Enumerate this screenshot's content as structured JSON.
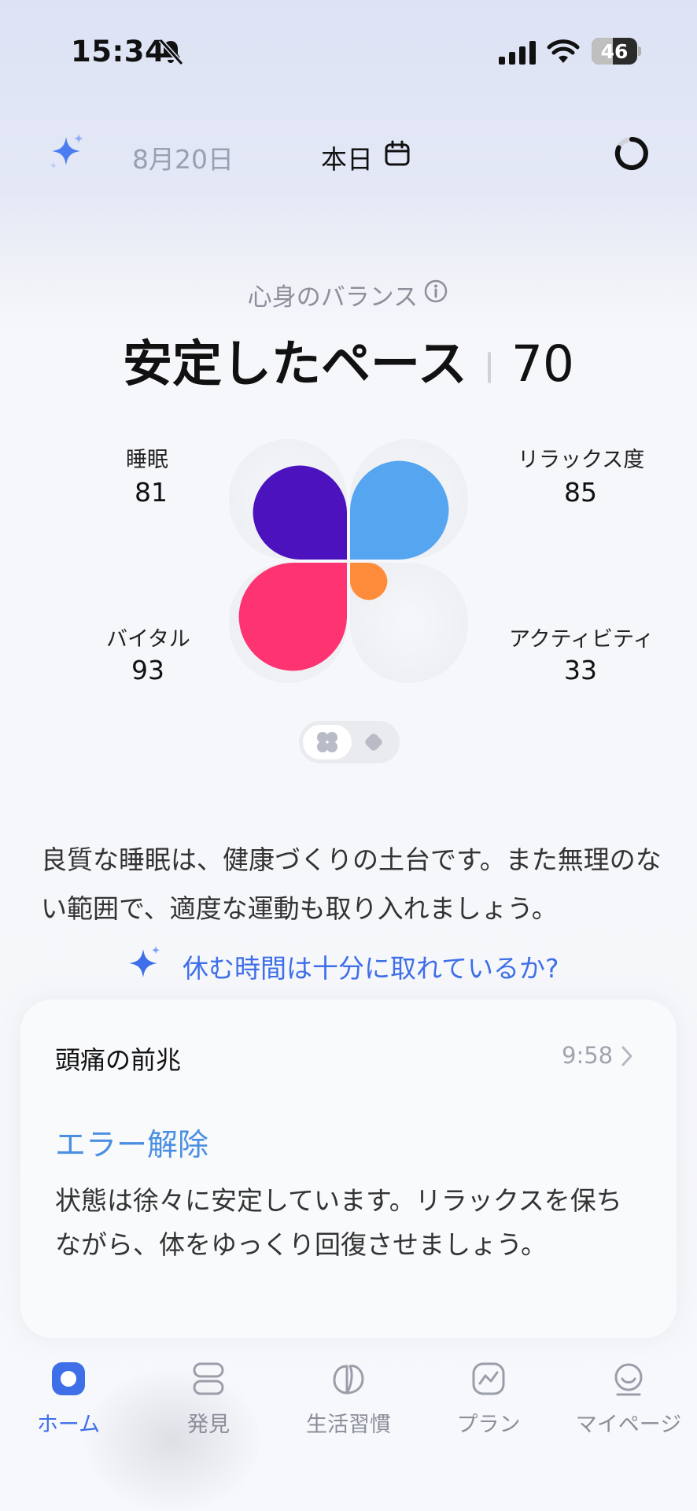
{
  "status_bar": {
    "time": "15:34",
    "battery": "46"
  },
  "header": {
    "date": "8月20日",
    "today_label": "本日"
  },
  "balance": {
    "label": "心身のバランス",
    "headline": "安定したペース",
    "score": "70",
    "metrics": {
      "sleep": {
        "label": "睡眠",
        "value": "81"
      },
      "relax": {
        "label": "リラックス度",
        "value": "85"
      },
      "vital": {
        "label": "バイタル",
        "value": "93"
      },
      "activity": {
        "label": "アクティビティ",
        "value": "33"
      }
    },
    "colors": {
      "sleep": "#4B12BE",
      "relax": "#56A5F0",
      "vital": "#FD3471",
      "activity": "#FF8C3B"
    }
  },
  "advice": {
    "text": "良質な睡眠は、健康づくりの土台です。また無理のない範囲で、適度な運動も取り入れましょう。",
    "prompt": "休む時間は十分に取れているか?"
  },
  "card": {
    "title": "頭痛の前兆",
    "time": "9:58",
    "heading": "エラー解除",
    "body": "状態は徐々に安定しています。リラックスを保ちながら、体をゆっくり回復させましょう。"
  },
  "nav": {
    "items": [
      {
        "label": "ホーム",
        "active": true
      },
      {
        "label": "発見"
      },
      {
        "label": "生活習慣"
      },
      {
        "label": "プラン"
      },
      {
        "label": "マイページ"
      }
    ]
  },
  "accent_color": "#3E6FE8"
}
